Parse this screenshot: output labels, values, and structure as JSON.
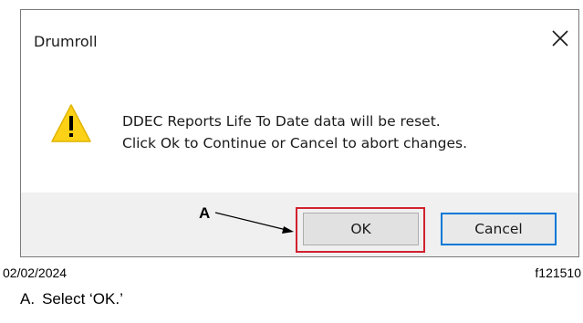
{
  "dialog": {
    "title": "Drumroll",
    "message_line1": "DDEC Reports Life To Date data will be reset.",
    "message_line2": "Click Ok to Continue or Cancel to abort changes.",
    "ok_label": "OK",
    "cancel_label": "Cancel",
    "close_icon": "close-icon",
    "warning_icon": "warning-icon"
  },
  "callout": {
    "letter": "A",
    "highlight_color": "#d2212f"
  },
  "figure": {
    "date": "02/02/2024",
    "id": "f121510"
  },
  "caption": {
    "letter": "A.",
    "text": "Select ‘OK.’"
  },
  "colors": {
    "focus_border": "#0078d7",
    "warning_fill": "#fcd116"
  }
}
